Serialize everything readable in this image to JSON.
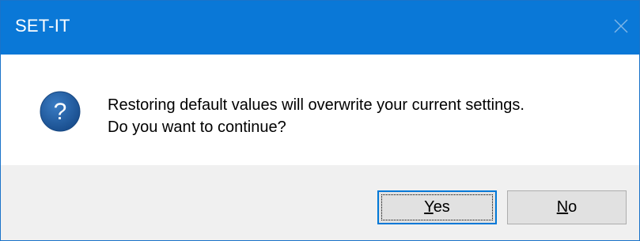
{
  "window": {
    "title": "SET-IT",
    "close_icon": "close-icon"
  },
  "dialog": {
    "icon": "question-icon",
    "icon_color": "#1e5c9e",
    "message_line1": "Restoring default values will overwrite your current settings.",
    "message_line2": "Do you want to continue?"
  },
  "buttons": {
    "yes": {
      "mnemonic": "Y",
      "rest": "es",
      "default": true
    },
    "no": {
      "mnemonic": "N",
      "rest": "o",
      "default": false
    }
  },
  "colors": {
    "titlebar": "#0a78d7",
    "footer": "#f0f0f0",
    "default_button_border": "#0078d7"
  }
}
